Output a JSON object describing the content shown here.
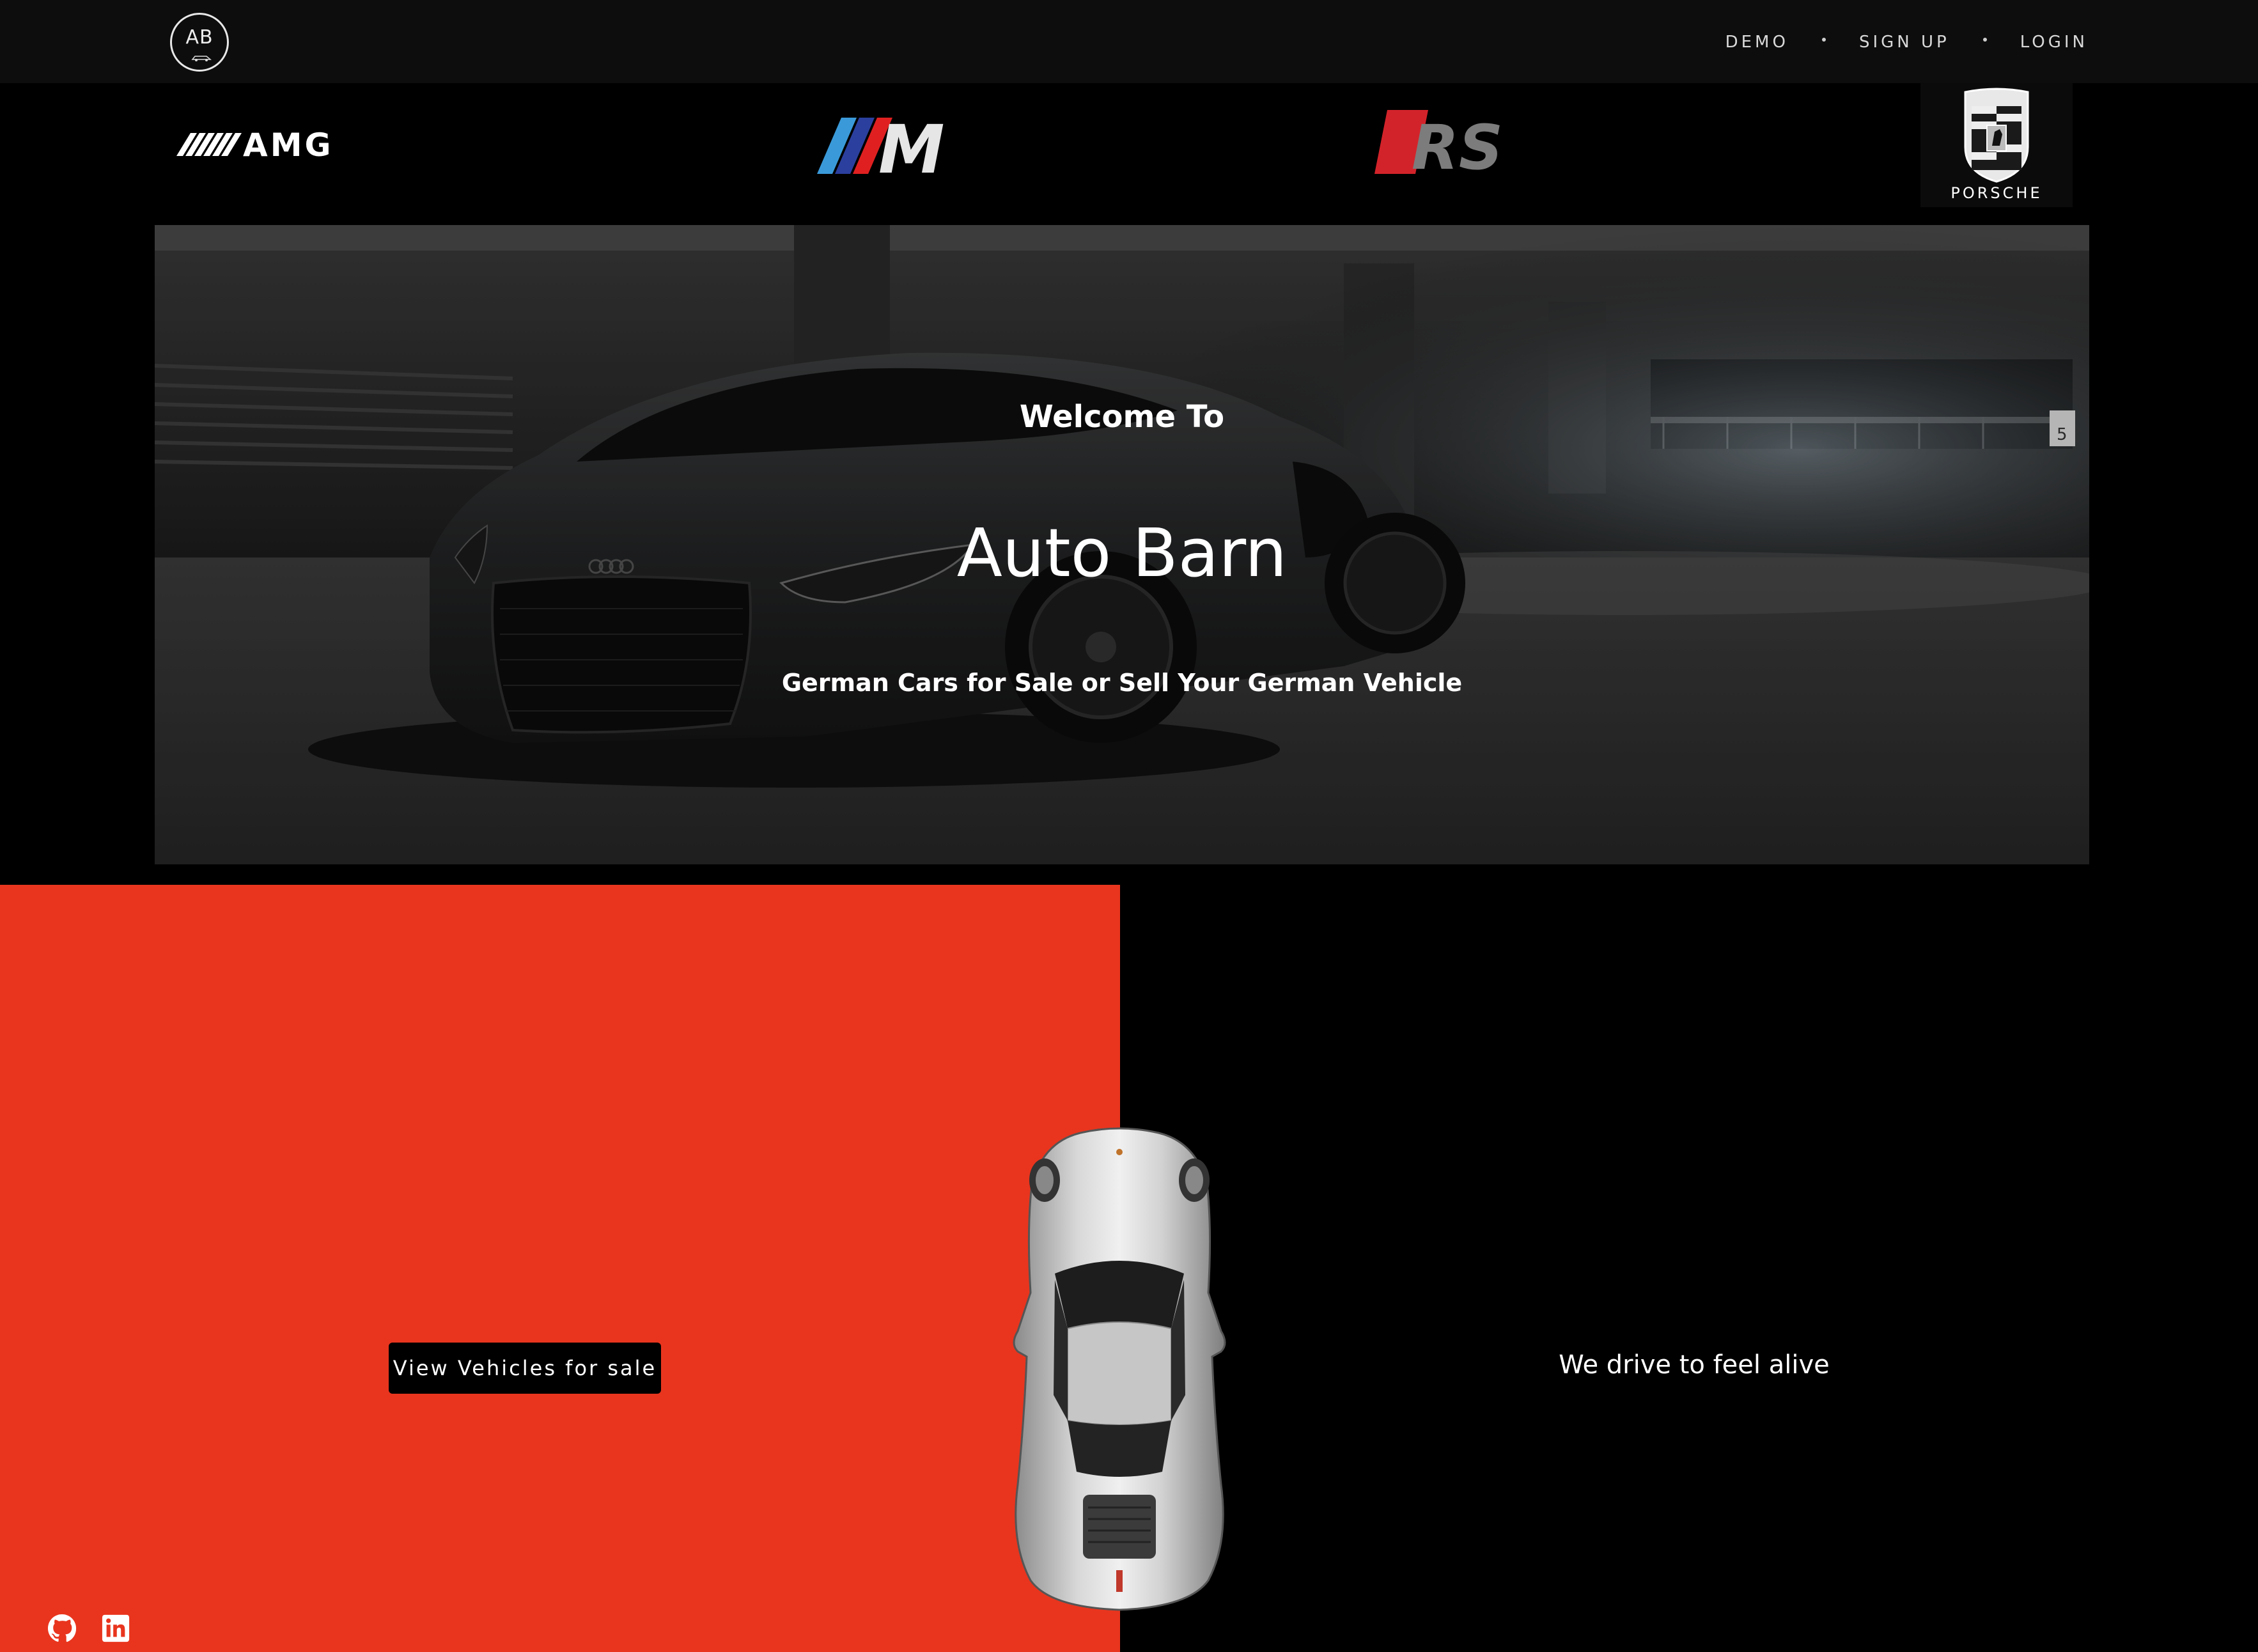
{
  "header": {
    "logo_text": "AB",
    "nav": {
      "demo": "DEMO",
      "signup": "SIGN UP",
      "login": "LOGIN"
    }
  },
  "brands": {
    "amg": "AMG",
    "m": "M",
    "rs": "RS",
    "porsche": "PORSCHE",
    "porsche_crest_text": "PORSCHE"
  },
  "hero": {
    "welcome": "Welcome To",
    "title": "Auto Barn",
    "subtitle": "German Cars for Sale or Sell Your German Vehicle",
    "sign_number": "5"
  },
  "cta": {
    "view_vehicles": "View Vehicles for sale"
  },
  "tagline": "We drive to feel alive",
  "colors": {
    "accent_red": "#e9351e",
    "nav_bg": "#0d0d0d",
    "page_bg": "#000000"
  },
  "footer_icons": [
    "github-icon",
    "linkedin-icon"
  ]
}
